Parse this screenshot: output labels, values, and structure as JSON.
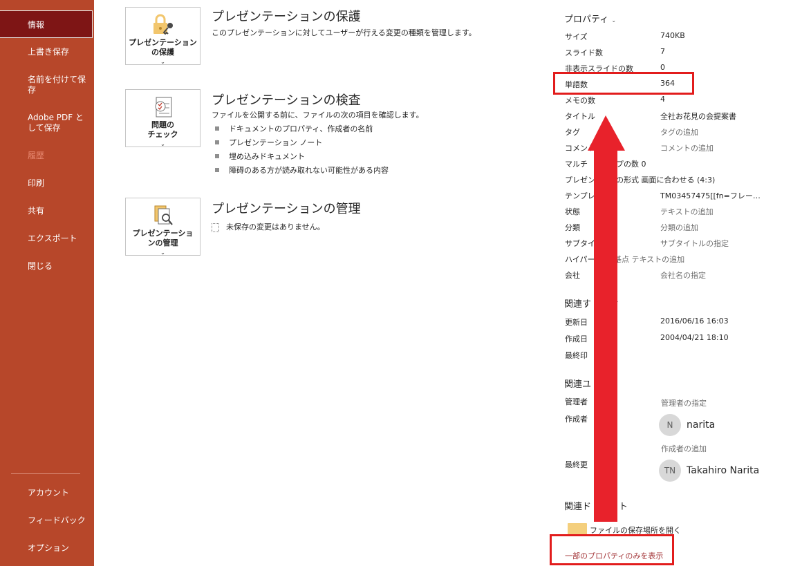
{
  "sidebar": {
    "items": [
      {
        "label": "情報"
      },
      {
        "label": "上書き保存"
      },
      {
        "label": "名前を付けて保存"
      },
      {
        "label": "Adobe PDF として保存"
      },
      {
        "label": "履歴"
      },
      {
        "label": "印刷"
      },
      {
        "label": "共有"
      },
      {
        "label": "エクスポート"
      },
      {
        "label": "閉じる"
      }
    ],
    "bottom_items": [
      {
        "label": "アカウント"
      },
      {
        "label": "フィードバック"
      },
      {
        "label": "オプション"
      }
    ]
  },
  "sections": {
    "protect": {
      "button_line1": "プレゼンテーション",
      "button_line2": "の保護",
      "title": "プレゼンテーションの保護",
      "description": "このプレゼンテーションに対してユーザーが行える変更の種類を管理します。"
    },
    "inspect": {
      "button_line1": "問題の",
      "button_line2": "チェック",
      "title": "プレゼンテーションの検査",
      "description": "ファイルを公開する前に、ファイルの次の項目を確認します。",
      "bullets": [
        "ドキュメントのプロパティ、作成者の名前",
        "プレゼンテーション ノート",
        "埋め込みドキュメント",
        "障碍のある方が読み取れない可能性がある内容"
      ]
    },
    "manage": {
      "button_line1": "プレゼンテーショ",
      "button_line2": "ンの管理",
      "title": "プレゼンテーションの管理",
      "status": "未保存の変更はありません。"
    }
  },
  "properties": {
    "heading": "プロパティ",
    "rows": [
      {
        "label": "サイズ",
        "value": "740KB"
      },
      {
        "label": "スライド数",
        "value": "7"
      },
      {
        "label": "非表示スライドの数",
        "value": "0"
      },
      {
        "label": "単語数",
        "value": "364"
      },
      {
        "label": "メモの数",
        "value": "4"
      },
      {
        "label": "タイトル",
        "value": "全社お花見の会提案書"
      },
      {
        "label": "タグ",
        "value": "タグの追加"
      },
      {
        "label": "コメント",
        "value": "コメントの追加"
      },
      {
        "label": "マルチ",
        "value": "ップの数 0"
      },
      {
        "label": "プレゼン",
        "value": "ンの形式 画面に合わせる (4:3)"
      },
      {
        "label": "テンプレ",
        "value": "TM03457475[[fn=フレー…"
      },
      {
        "label": "状態",
        "value": "テキストの追加"
      },
      {
        "label": "分類",
        "value": "分類の追加"
      },
      {
        "label": "サブタイ",
        "value": "サブタイトルの指定"
      },
      {
        "label": "ハイパー",
        "value": "基点 テキストの追加"
      },
      {
        "label": "会社",
        "value": "会社名の指定"
      }
    ]
  },
  "related_dates": {
    "heading": "関連す",
    "heading_tail": "付",
    "rows": [
      {
        "label": "更新日",
        "value": "2016/06/16 16:03"
      },
      {
        "label": "作成日",
        "value": "2004/04/21 18:10"
      },
      {
        "label": "最終印",
        "value": ""
      }
    ]
  },
  "related_people": {
    "heading": "関連ユ",
    "manager_label": "管理者",
    "manager_value": "管理者の指定",
    "author_label": "作成者",
    "author_initial": "N",
    "author_name": "narita",
    "add_author": "作成者の追加",
    "last_modified_label": "最終更",
    "last_modified_initials": "TN",
    "last_modified_name": "Takahiro Narita"
  },
  "related_docs": {
    "heading": "関連ド",
    "heading_tail": "ト",
    "open_location": "ファイルの保存場所を開く"
  },
  "show_fewer": "一部のプロパティのみを表示",
  "colors": {
    "sidebar": "#b7472a",
    "sidebar_active": "#7e1515",
    "highlight": "#e21c1c"
  }
}
